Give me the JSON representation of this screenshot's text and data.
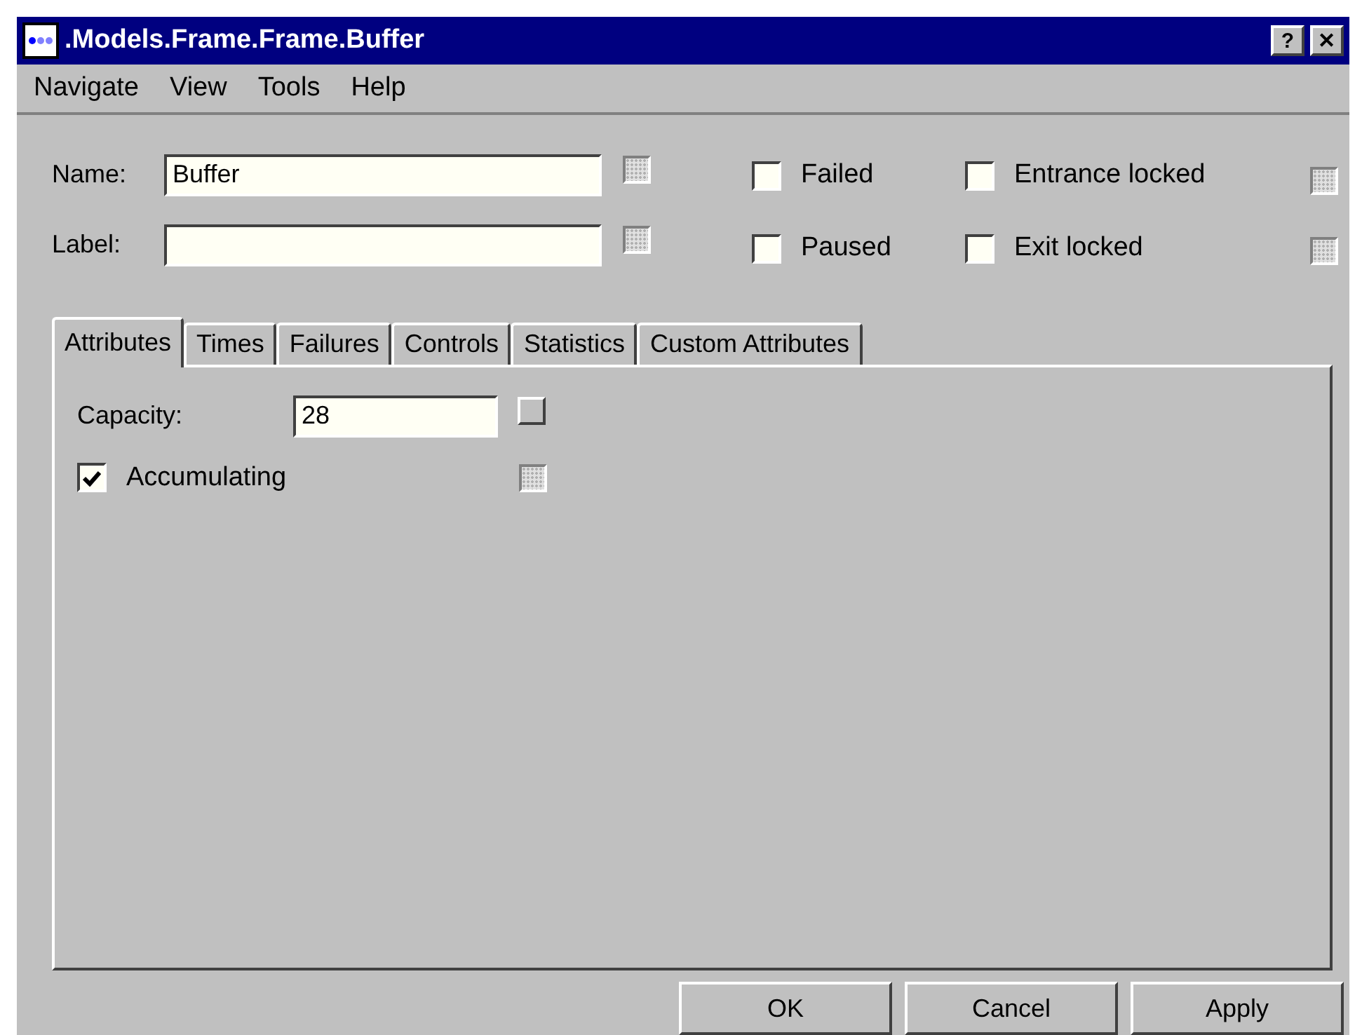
{
  "window": {
    "title": ".Models.Frame.Frame.Buffer",
    "title_buttons": [
      "?",
      "✕"
    ]
  },
  "menu": [
    "Navigate",
    "View",
    "Tools",
    "Help"
  ],
  "fields": [
    {
      "label": "Name:",
      "value": "Buffer",
      "indicator": {
        "kind": "checkbox",
        "disabled": true
      }
    },
    {
      "label": "Label:",
      "indicator": {
        "kind": "checkbox",
        "disabled": true
      }
    }
  ],
  "flags": [
    {
      "label": "Failed",
      "checked": false
    },
    {
      "label": "Entrance locked",
      "checked": false
    },
    {
      "label": "Paused",
      "checked": false
    },
    {
      "label": "Exit locked",
      "checked": false
    }
  ],
  "flag_indicators": [
    {
      "kind": "checkbox",
      "disabled": true
    },
    {
      "kind": "checkbox",
      "disabled": true
    }
  ],
  "tabs": [
    {
      "label": "Attributes",
      "selected": true
    },
    {
      "label": "Times",
      "selected": false
    },
    {
      "label": "Failures",
      "selected": false
    },
    {
      "label": "Controls",
      "selected": false
    },
    {
      "label": "Statistics",
      "selected": false
    },
    {
      "label": "Custom Attributes",
      "selected": false
    }
  ],
  "attributes": {
    "capacity": {
      "label": "Capacity:",
      "value": "28",
      "indicator": {
        "kind": "button"
      }
    },
    "accumulating": {
      "label": "Accumulating",
      "checked": true,
      "indicator": {
        "kind": "checkbox",
        "disabled": true
      }
    }
  },
  "buttons": [
    "OK",
    "Cancel",
    "Apply"
  ]
}
